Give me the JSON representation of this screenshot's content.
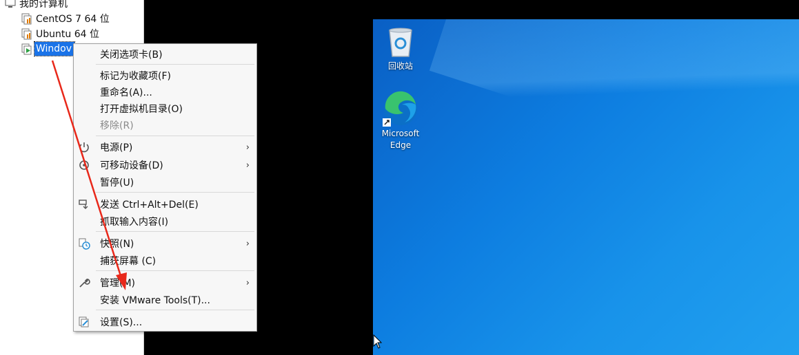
{
  "library": {
    "root_label": "我的计算机",
    "vms": [
      {
        "label": "CentOS 7 64 位"
      },
      {
        "label": "Ubuntu 64 位"
      },
      {
        "label": "Windov"
      }
    ]
  },
  "desktop": {
    "recycle_bin": "回收站",
    "edge_line1": "Microsoft",
    "edge_line2": "Edge"
  },
  "context_menu": {
    "items": [
      {
        "label": "关闭选项卡(B)"
      },
      {
        "label": "标记为收藏项(F)"
      },
      {
        "label": "重命名(A)..."
      },
      {
        "label": "打开虚拟机目录(O)"
      },
      {
        "label": "移除(R)",
        "disabled": true
      },
      {
        "label": "电源(P)",
        "icon": "power-icon",
        "submenu": true
      },
      {
        "label": "可移动设备(D)",
        "icon": "removable-device-icon",
        "submenu": true
      },
      {
        "label": "暂停(U)"
      },
      {
        "label": "发送 Ctrl+Alt+Del(E)",
        "icon": "send-keys-icon"
      },
      {
        "label": "抓取输入内容(I)"
      },
      {
        "label": "快照(N)",
        "icon": "snapshot-icon",
        "submenu": true
      },
      {
        "label": "捕获屏幕 (C)"
      },
      {
        "label": "管理(M)",
        "icon": "wrench-icon",
        "submenu": true
      },
      {
        "label": "安装 VMware Tools(T)..."
      },
      {
        "label": "设置(S)...",
        "icon": "settings-icon"
      }
    ],
    "submenu_glyph": "›"
  },
  "colors": {
    "selection": "#1a73e8",
    "annotation_arrow": "#e8281a",
    "desktop_blue": "#0d7de0"
  }
}
